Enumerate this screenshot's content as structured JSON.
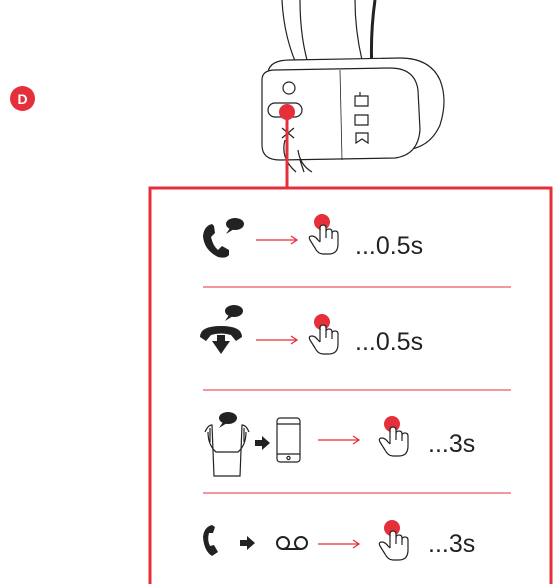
{
  "step": {
    "label": "D"
  },
  "device": {
    "button_icons": [
      "button-circle",
      "bluetooth",
      "phone"
    ]
  },
  "actions": [
    {
      "name": "answer-call",
      "icon": "incoming-call-icon",
      "duration": "...0.5s"
    },
    {
      "name": "end-call",
      "icon": "hang-up-icon",
      "duration": "...0.5s"
    },
    {
      "name": "transfer-to-phone",
      "icon": "headset-to-phone-icon",
      "duration": "...3s"
    },
    {
      "name": "reject-to-voicemail",
      "icon": "voicemail-icon",
      "duration": "...3s"
    }
  ],
  "colors": {
    "accent": "#e5303b",
    "ink": "#222222",
    "divider": "#e5303b"
  }
}
